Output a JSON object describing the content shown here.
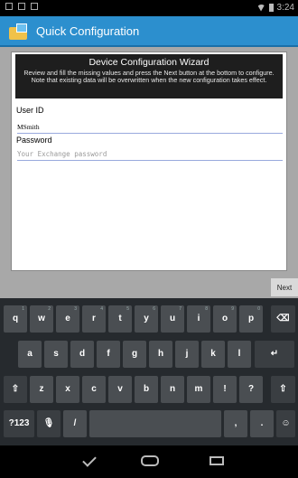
{
  "status": {
    "time": "3:24"
  },
  "action_bar": {
    "title": "Quick Configuration",
    "icon": "app-config-icon"
  },
  "wizard": {
    "title": "Device Configuration Wizard",
    "description": "Review and fill the missing values and press the Next button at the bottom to configure. Note that existing data will be overwritten when the new configuration takes effect."
  },
  "form": {
    "user_id_label": "User ID",
    "user_id_value": "MSmith",
    "password_label": "Password",
    "password_placeholder": "Your Exchange password"
  },
  "buttons": {
    "next": "Next"
  },
  "keyboard": {
    "row1": [
      "q",
      "w",
      "e",
      "r",
      "t",
      "y",
      "u",
      "i",
      "o",
      "p"
    ],
    "row1_hints": [
      "1",
      "2",
      "3",
      "4",
      "5",
      "6",
      "7",
      "8",
      "9",
      "0"
    ],
    "row2": [
      "a",
      "s",
      "d",
      "f",
      "g",
      "h",
      "j",
      "k",
      "l"
    ],
    "row3": [
      "z",
      "x",
      "c",
      "v",
      "b",
      "n",
      "m",
      "!",
      "?"
    ],
    "row4": {
      "symbols": "?123",
      "slash": "/",
      "comma": ",",
      "period": "."
    }
  }
}
